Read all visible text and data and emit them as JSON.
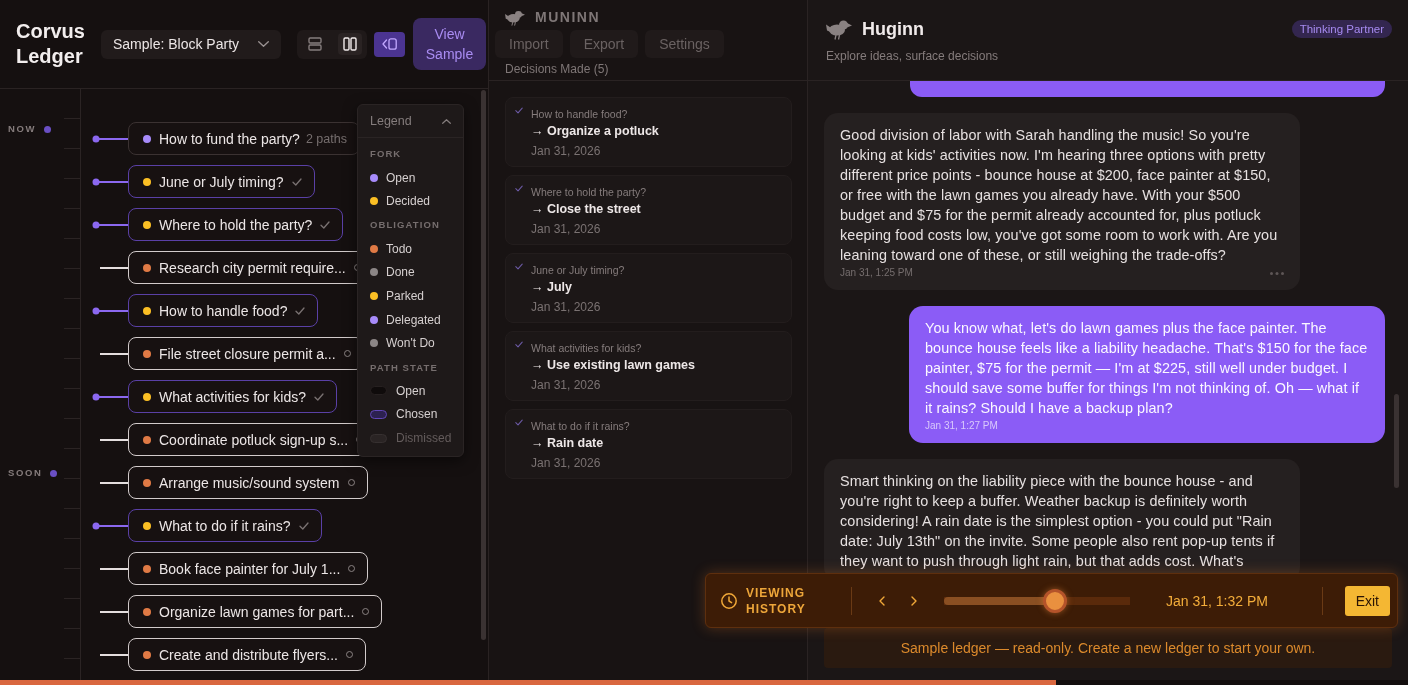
{
  "app": {
    "title": "Corvus Ledger"
  },
  "toolbar": {
    "ledger_select": {
      "value": "Sample: Block Party"
    },
    "view_modes": [
      {
        "kind": "stacked",
        "selected": false
      },
      {
        "kind": "split",
        "selected": true
      }
    ],
    "panel_toggle": {
      "on": true
    },
    "view_sample": {
      "label": "View Sample"
    }
  },
  "timeline": {
    "items": [
      {
        "kind": "fork",
        "color": "#a78bfa",
        "decided": false,
        "label": "How to fund the party?",
        "paths": "2 paths",
        "marker": "NOW"
      },
      {
        "kind": "fork",
        "color": "#fbbf24",
        "decided": true,
        "label": "June or July timing?"
      },
      {
        "kind": "fork",
        "color": "#fbbf24",
        "decided": true,
        "label": "Where to hold the party?"
      },
      {
        "kind": "obligation",
        "color": "#e07a45",
        "done": false,
        "label": "Research city permit require..."
      },
      {
        "kind": "fork",
        "color": "#fbbf24",
        "decided": true,
        "label": "How to handle food?"
      },
      {
        "kind": "obligation",
        "color": "#e07a45",
        "done": false,
        "label": "File street closure permit a..."
      },
      {
        "kind": "fork",
        "color": "#fbbf24",
        "decided": true,
        "label": "What activities for kids?"
      },
      {
        "kind": "obligation",
        "color": "#e07a45",
        "done": false,
        "label": "Coordinate potluck sign-up s..."
      },
      {
        "kind": "obligation",
        "color": "#e07a45",
        "done": false,
        "label": "Arrange music/sound system",
        "marker": "SOON"
      },
      {
        "kind": "fork",
        "color": "#fbbf24",
        "decided": true,
        "label": "What to do if it rains?"
      },
      {
        "kind": "obligation",
        "color": "#e07a45",
        "done": false,
        "label": "Book face painter for July 1..."
      },
      {
        "kind": "obligation",
        "color": "#e07a45",
        "done": false,
        "label": "Organize lawn games for part..."
      },
      {
        "kind": "obligation",
        "color": "#e07a45",
        "done": false,
        "label": "Create and distribute flyers..."
      }
    ]
  },
  "legend": {
    "title": "Legend",
    "expanded": true,
    "sections": [
      {
        "heading": "FORK",
        "items": [
          {
            "kind": "dot",
            "label": "Open",
            "color": "#a78bfa"
          },
          {
            "kind": "dot",
            "label": "Decided",
            "color": "#fbbf24"
          }
        ]
      },
      {
        "heading": "OBLIGATION",
        "items": [
          {
            "kind": "dot",
            "label": "Todo",
            "color": "#e07a45"
          },
          {
            "kind": "dot",
            "label": "Done",
            "color": "#8c8686"
          },
          {
            "kind": "dot",
            "label": "Parked",
            "color": "#fbbf24"
          },
          {
            "kind": "dot",
            "label": "Delegated",
            "color": "#a78bfa"
          },
          {
            "kind": "dot",
            "label": "Won't Do",
            "color": "#8c8686"
          }
        ]
      },
      {
        "heading": "PATH STATE",
        "items": [
          {
            "kind": "openpath",
            "label": "Open"
          },
          {
            "kind": "chosenpath",
            "label": "Chosen"
          },
          {
            "kind": "dismissedpath",
            "label": "Dismissed"
          }
        ]
      }
    ]
  },
  "muninn": {
    "title": "MUNINN",
    "actions": [
      {
        "label": "Import",
        "disabled": true
      },
      {
        "label": "Export",
        "disabled": true
      },
      {
        "label": "Settings",
        "disabled": true
      }
    ],
    "subtitle": "Decisions Made (5)",
    "decisions": [
      {
        "question": "How to handle food?",
        "answer": "→ Organize a potluck",
        "date": "Jan 31, 2026"
      },
      {
        "question": "Where to hold the party?",
        "answer": "→ Close the street",
        "date": "Jan 31, 2026"
      },
      {
        "question": "June or July timing?",
        "answer": "→ July",
        "date": "Jan 31, 2026"
      },
      {
        "question": "What activities for kids?",
        "answer": "→ Use existing lawn games",
        "date": "Jan 31, 2026"
      },
      {
        "question": "What to do if it rains?",
        "answer": "→ Rain date",
        "date": "Jan 31, 2026"
      }
    ]
  },
  "huginn": {
    "title": "Huginn",
    "badge": "Thinking Partner",
    "subtitle": "Explore ideas, surface decisions",
    "messages": [
      {
        "kind": "user",
        "scrolled_off": true
      },
      {
        "kind": "assistant",
        "text": "Good division of labor with Sarah handling the music! So you're looking at kids' activities now. I'm hearing three options with pretty different price points - bounce house at $200, face painter at $150, or free with the lawn games you already have. With your $500 budget and $75 for the permit already accounted for, plus potluck keeping food costs low, you've got some room to work with. Are you leaning toward one of these, or still weighing the trade-offs?",
        "time": "Jan 31, 1:25 PM",
        "hovered": true
      },
      {
        "kind": "user",
        "text": "You know what, let's do lawn games plus the face painter. The bounce house feels like a liability headache. That's $150 for the face painter, $75 for the permit — I'm at $225, still well under budget. I should save some buffer for things I'm not thinking of. Oh — what if it rains? Should I have a backup plan?",
        "time": "Jan 31, 1:27 PM",
        "hovered": false
      },
      {
        "kind": "assistant",
        "text": "Smart thinking on the liability piece with the bounce house - and you're right to keep a buffer. Weather backup is definitely worth considering! A rain date is the simplest option - you could put \"Rain date: July 13th\" on the invite. Some people also rent pop-up tents if they want to push through light rain, but that adds cost. What's"
      }
    ],
    "notice": "Sample ledger — read-only. Create a new ledger to start your own."
  },
  "history_bar": {
    "label": "VIEWING HISTORY",
    "level": 0.61,
    "time": "Jan 31, 1:32 PM",
    "exit": "Exit"
  },
  "playback_progress": {
    "level": 0.75
  }
}
